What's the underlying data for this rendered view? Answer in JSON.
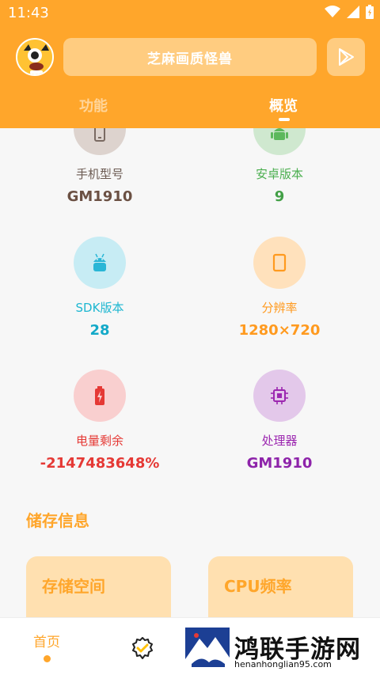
{
  "status_bar": {
    "time": "11:43",
    "icons": [
      "wifi-icon",
      "signal-icon",
      "battery-icon"
    ]
  },
  "header": {
    "app_title": "芝麻画质怪兽",
    "tabs": [
      {
        "label": "功能",
        "active": false
      },
      {
        "label": "概览",
        "active": true
      }
    ]
  },
  "overview": {
    "items": [
      {
        "label": "手机型号",
        "value": "GM1910",
        "icon": "phone-icon",
        "label_color": "#6b5a52",
        "value_color": "#6b5043",
        "circle_color": "#DDD3CE"
      },
      {
        "label": "安卓版本",
        "value": "9",
        "icon": "android-icon",
        "label_color": "#4CAF50",
        "value_color": "#43A047",
        "circle_color": "#CFE8CF"
      },
      {
        "label": "SDK版本",
        "value": "28",
        "icon": "android-icon",
        "label_color": "#1EB7D1",
        "value_color": "#13A9C8",
        "circle_color": "#C7ECF4"
      },
      {
        "label": "分辨率",
        "value": "1280×720",
        "icon": "screen-icon",
        "label_color": "#FF9A1F",
        "value_color": "#FF9A1F",
        "circle_color": "#FFE1BC"
      },
      {
        "label": "电量剩余",
        "value": "-2147483648%",
        "icon": "battery-charge-icon",
        "label_color": "#E53935",
        "value_color": "#E53935",
        "circle_color": "#F9CFCF"
      },
      {
        "label": "处理器",
        "value": "GM1910",
        "icon": "cpu-icon",
        "label_color": "#9C27B0",
        "value_color": "#8E24AA",
        "circle_color": "#E3C8EA"
      }
    ]
  },
  "storage": {
    "section_title": "储存信息",
    "cards": [
      {
        "title": "存储空间"
      },
      {
        "title": "CPU频率"
      }
    ]
  },
  "bottom_nav": {
    "home_label": "首页"
  },
  "watermark": {
    "text": "鸿联手游网",
    "url": "henanhonglian95.com"
  },
  "colors": {
    "accent": "#FFA62B",
    "light_accent": "#FFCC80"
  }
}
